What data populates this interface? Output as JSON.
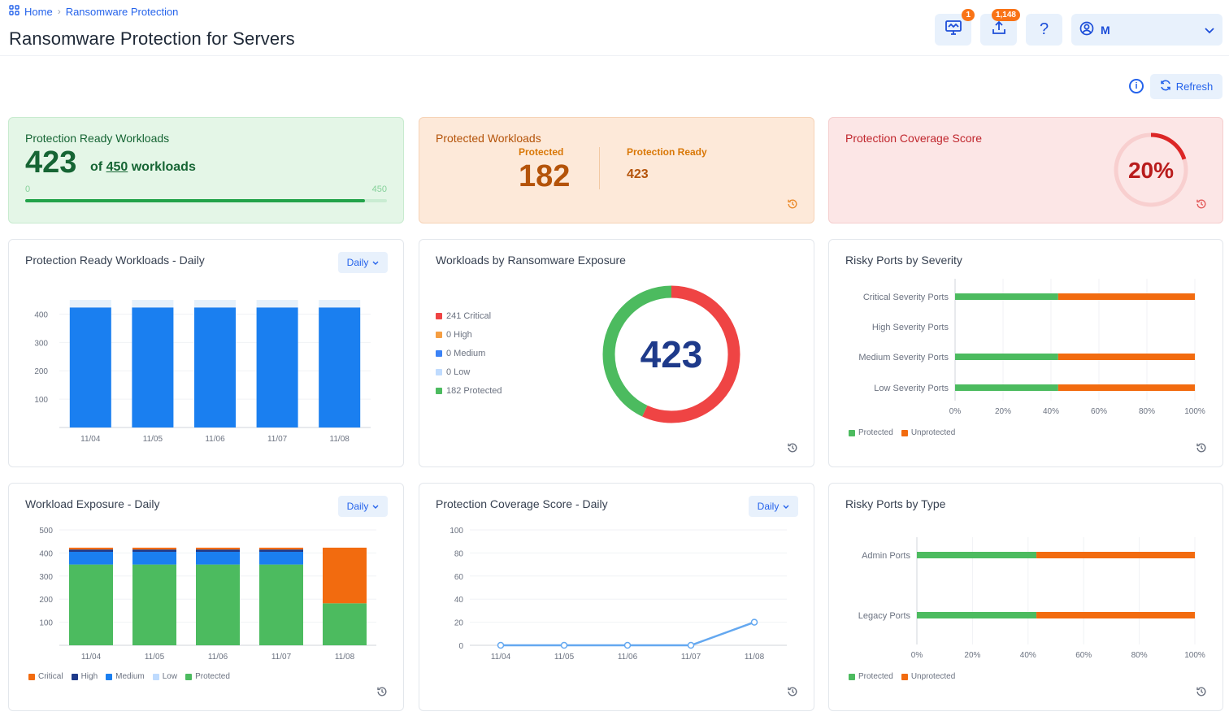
{
  "breadcrumb": {
    "home": "Home",
    "current": "Ransomware Protection"
  },
  "page": {
    "title": "Ransomware Protection for Servers"
  },
  "header": {
    "monitor_badge": "1",
    "upload_badge": "1,148",
    "help": "?",
    "user_initial": "M"
  },
  "toolbar": {
    "refresh_label": "Refresh",
    "info": "i"
  },
  "stat_ready": {
    "title": "Protection Ready Workloads",
    "value": "423",
    "of_prefix": "of",
    "total": "450",
    "of_suffix": "workloads",
    "scale_min": "0",
    "scale_max": "450",
    "progress_fraction": 0.94
  },
  "stat_protected": {
    "title": "Protected Workloads",
    "protected_label": "Protected",
    "protected_value": "182",
    "ready_label": "Protection Ready",
    "ready_value": "423"
  },
  "stat_coverage": {
    "title": "Protection Coverage Score",
    "value": "20%",
    "fraction": 0.2,
    "colors": {
      "track": "#f8cfcf",
      "arc": "#dc2626"
    }
  },
  "panels": {
    "ready_daily": {
      "title": "Protection Ready Workloads - Daily",
      "period": "Daily"
    },
    "exposure": {
      "title": "Workloads by Ransomware Exposure"
    },
    "ports_severity": {
      "title": "Risky Ports by Severity"
    },
    "exposure_daily": {
      "title": "Workload Exposure - Daily",
      "period": "Daily"
    },
    "coverage_daily": {
      "title": "Protection Coverage Score - Daily",
      "period": "Daily"
    },
    "ports_type": {
      "title": "Risky Ports by Type"
    }
  },
  "chart_data": [
    {
      "id": "ready_daily",
      "type": "bar",
      "categories": [
        "11/04",
        "11/05",
        "11/06",
        "11/07",
        "11/08"
      ],
      "values": [
        423,
        423,
        423,
        423,
        423
      ],
      "background_values": [
        450,
        450,
        450,
        450,
        450
      ],
      "ylim": [
        0,
        450
      ],
      "yticks": [
        100,
        200,
        300,
        400
      ],
      "colors": {
        "bar": "#1a7ff0",
        "bg": "#e6f1fb"
      }
    },
    {
      "id": "exposure",
      "type": "pie",
      "center_label": "423",
      "slices": [
        {
          "label": "Critical",
          "value": 241,
          "color": "#ef4444"
        },
        {
          "label": "High",
          "value": 0,
          "color": "#f59e42"
        },
        {
          "label": "Medium",
          "value": 0,
          "color": "#3b82f6"
        },
        {
          "label": "Low",
          "value": 0,
          "color": "#bfdbfe"
        },
        {
          "label": "Protected",
          "value": 182,
          "color": "#4cbb5f"
        }
      ],
      "legend": [
        "241 Critical",
        "0 High",
        "0 Medium",
        "0 Low",
        "182 Protected"
      ]
    },
    {
      "id": "ports_severity",
      "type": "bar",
      "orientation": "horizontal",
      "categories": [
        "Critical Severity Ports",
        "High Severity Ports",
        "Medium Severity Ports",
        "Low Severity Ports"
      ],
      "series": [
        {
          "name": "Protected",
          "values": [
            43,
            0,
            43,
            43
          ],
          "color": "#4cbb5f"
        },
        {
          "name": "Unprotected",
          "values": [
            57,
            0,
            57,
            57
          ],
          "color": "#f26b0f"
        }
      ],
      "xticks": [
        "0%",
        "20%",
        "40%",
        "60%",
        "80%",
        "100%"
      ],
      "xlim": [
        0,
        100
      ]
    },
    {
      "id": "exposure_daily",
      "type": "bar",
      "stacked": true,
      "categories": [
        "11/04",
        "11/05",
        "11/06",
        "11/07",
        "11/08"
      ],
      "series": [
        {
          "name": "Protected",
          "values": [
            350,
            350,
            350,
            350,
            182
          ],
          "color": "#4cbb5f"
        },
        {
          "name": "Low",
          "values": [
            0,
            0,
            0,
            0,
            0
          ],
          "color": "#bfdbfe"
        },
        {
          "name": "Medium",
          "values": [
            55,
            55,
            55,
            55,
            0
          ],
          "color": "#1a7ff0"
        },
        {
          "name": "High",
          "values": [
            10,
            10,
            10,
            10,
            0
          ],
          "color": "#1e3a8a"
        },
        {
          "name": "Critical",
          "values": [
            8,
            8,
            8,
            8,
            241
          ],
          "color": "#f26b0f"
        }
      ],
      "legend_order": [
        "Critical",
        "High",
        "Medium",
        "Low",
        "Protected"
      ],
      "ylim": [
        0,
        500
      ],
      "yticks": [
        100,
        200,
        300,
        400,
        500
      ]
    },
    {
      "id": "coverage_daily",
      "type": "line",
      "x": [
        "11/04",
        "11/05",
        "11/06",
        "11/07",
        "11/08"
      ],
      "values": [
        0,
        0,
        0,
        0,
        20
      ],
      "ylim": [
        0,
        100
      ],
      "yticks": [
        0,
        20,
        40,
        60,
        80,
        100
      ],
      "colors": {
        "line": "#64a8f0"
      }
    },
    {
      "id": "ports_type",
      "type": "bar",
      "orientation": "horizontal",
      "categories": [
        "Admin Ports",
        "Legacy Ports"
      ],
      "series": [
        {
          "name": "Protected",
          "values": [
            43,
            43
          ],
          "color": "#4cbb5f"
        },
        {
          "name": "Unprotected",
          "values": [
            57,
            57
          ],
          "color": "#f26b0f"
        }
      ],
      "xticks": [
        "0%",
        "20%",
        "40%",
        "60%",
        "80%",
        "100%"
      ],
      "xlim": [
        0,
        100
      ]
    }
  ]
}
